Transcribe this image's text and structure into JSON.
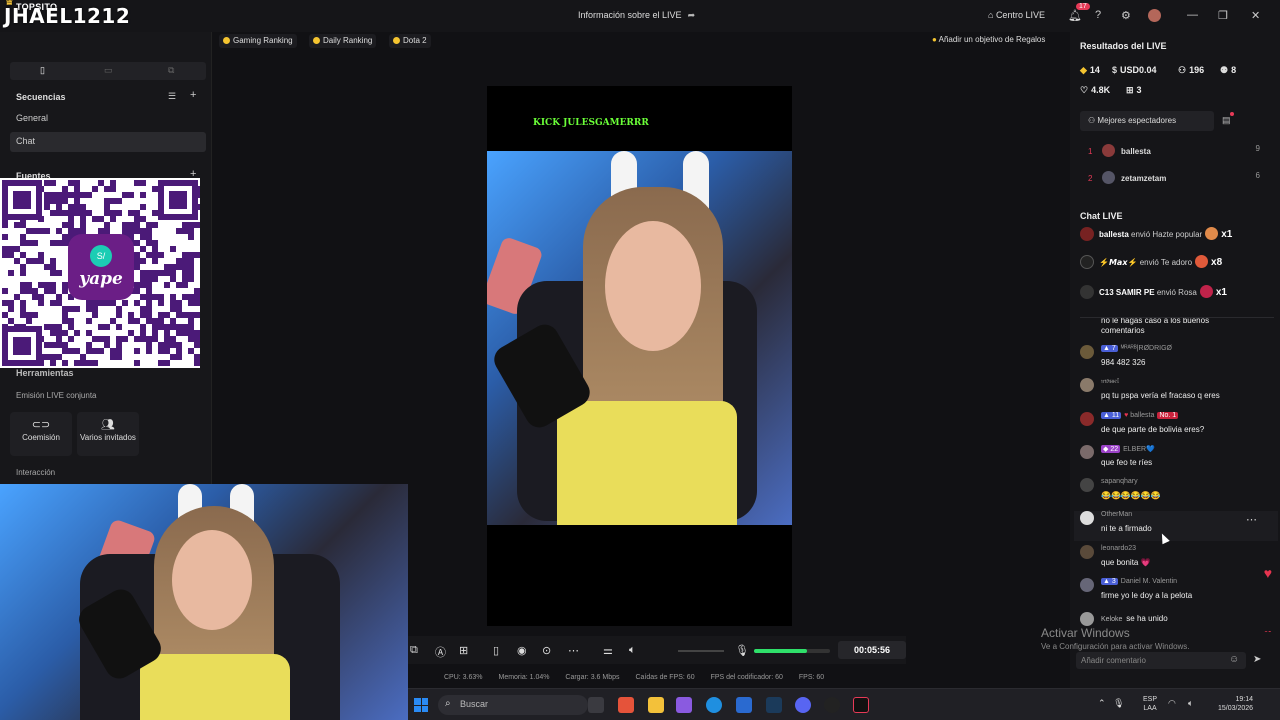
{
  "top_tag": "TOPSITO",
  "title_bar": {
    "title": "Información sobre el LIVE",
    "centro_live": "Centro LIVE",
    "notifications": "17"
  },
  "overlay_logo": "JHAEL1212",
  "left_panel": {
    "secuencias_title": "Secuencias",
    "items": [
      "General",
      "Chat"
    ],
    "fuentes_title": "Fuentes",
    "herramientas_title": "Herramientas",
    "emision_title": "Emisión LIVE conjunta",
    "tools": [
      "Coemisión",
      "Varios invitados"
    ],
    "interaccion_title": "Interacción",
    "qr_text": "yape",
    "qr_currency": "S/"
  },
  "chips": [
    "Gaming Ranking",
    "Daily Ranking",
    "Dota 2"
  ],
  "goal_button": "Añadir un objetivo de Regalos",
  "stage": {
    "overlay_text": "KICK JULESGAMERRR"
  },
  "controls": {
    "timer": "00:05:56",
    "mic_level_percent": 70
  },
  "stats": {
    "cpu": "CPU: 3.63%",
    "memoria": "Memoria: 1.04%",
    "cargar": "Cargar: 3.6 Mbps",
    "caidas": "Caídas de FPS: 60",
    "fps_codificador": "FPS del codificador: 60",
    "fps": "FPS: 60"
  },
  "right_panel": {
    "results_title": "Resultados del LIVE",
    "stats": {
      "diamonds": "14",
      "usd": "USD0.04",
      "viewers": "196",
      "new": "8",
      "likes": "4.8K",
      "gifters": "3"
    },
    "best_viewers_label": "Mejores espectadores",
    "ranking": [
      {
        "rank": "1",
        "name": "ballesta",
        "value": "9"
      },
      {
        "rank": "2",
        "name": "zetamzetam",
        "value": "6"
      }
    ],
    "chat_title": "Chat LIVE",
    "gifts": [
      {
        "user": "ballesta",
        "action": "envió Hazte popular",
        "count": "x1"
      },
      {
        "user": "⚡𝙈𝙖𝙭⚡",
        "action": "envió Te adoro",
        "count": "x8"
      },
      {
        "user": "C13 SAMIR PE",
        "action": "envió Rosa",
        "count": "x1"
      }
    ],
    "messages": [
      {
        "user": "",
        "level": "",
        "text": "no le hagas caso a los buenos comentarios"
      },
      {
        "user": "ᴹᴿᴬᴿᴮ|RØDRIGØ",
        "level": "7",
        "text": "984 482 326"
      },
      {
        "user": "𝔪𝔬𝔰𝔰𝔢𝔩",
        "level": "",
        "text": "pq tu pspa vería el fracaso q eres"
      },
      {
        "user": "ballesta",
        "level": "11",
        "badge": "No. 1",
        "text": "de que parte de bolivia eres?"
      },
      {
        "user": "ELBER💙",
        "level": "22",
        "text": "que feo te ríes"
      },
      {
        "user": "sapanqhary",
        "level": "",
        "text": "😂😂😂😂😂😂"
      },
      {
        "user": "OtherMan",
        "level": "",
        "text": "ni te a firmado"
      },
      {
        "user": "leonardo23",
        "level": "",
        "text": "que bonita 💗"
      },
      {
        "user": "Daniel M. Valentin",
        "level": "3",
        "text": "firme yo le doy a la pelota"
      },
      {
        "user": "Keloke",
        "level": "",
        "text": "se ha unido"
      }
    ],
    "comment_placeholder": "Añadir comentario"
  },
  "watermark": {
    "line1": "Activar Windows",
    "line2": "Ve a Configuración para activar Windows."
  },
  "taskbar": {
    "search_label": "Buscar",
    "lang_line1": "ESP",
    "lang_line2": "LAA",
    "time": "19:14",
    "date": "15/03/2026"
  }
}
